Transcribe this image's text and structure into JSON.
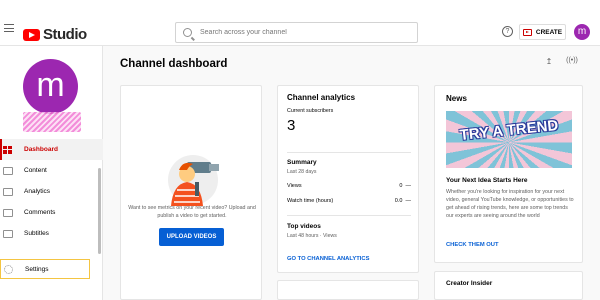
{
  "header": {
    "logo_text": "Studio",
    "search_placeholder": "Search across your channel",
    "help_icon_glyph": "?",
    "create_label": "CREATE",
    "avatar_letter": "m"
  },
  "sidebar": {
    "avatar_letter": "m",
    "items": [
      {
        "label": "Dashboard",
        "icon": "dashboard-icon",
        "active": true
      },
      {
        "label": "Content",
        "icon": "content-icon",
        "active": false
      },
      {
        "label": "Analytics",
        "icon": "analytics-icon",
        "active": false
      },
      {
        "label": "Comments",
        "icon": "comments-icon",
        "active": false
      },
      {
        "label": "Subtitles",
        "icon": "subtitles-icon",
        "active": false
      }
    ],
    "settings_label": "Settings"
  },
  "main": {
    "title": "Channel dashboard",
    "upload_card": {
      "text": "Want to see metrics on your recent video? Upload and publish a video to get started.",
      "button_label": "UPLOAD VIDEOS"
    },
    "analytics_card": {
      "title": "Channel analytics",
      "subscribers_label": "Current subscribers",
      "subscribers_value": "3",
      "summary_title": "Summary",
      "summary_period": "Last 28 days",
      "rows": [
        {
          "label": "Views",
          "value": "0",
          "trend": "—"
        },
        {
          "label": "Watch time (hours)",
          "value": "0.0",
          "trend": "—"
        }
      ],
      "top_videos_title": "Top videos",
      "top_videos_period": "Last 48 hours · Views",
      "link_label": "GO TO CHANNEL ANALYTICS"
    },
    "news_card": {
      "title": "News",
      "banner_text": "TRY A TREND",
      "headline": "Your Next Idea Starts Here",
      "body": "Whether you're looking for inspiration for your next video, general YouTube knowledge, or opportunities to get ahead of rising trends, here are some top trends our experts are seeing around the world",
      "link_label": "CHECK THEM OUT"
    },
    "insider_card": {
      "title": "Creator Insider"
    }
  },
  "colors": {
    "brand_red": "#ff0000",
    "active_red": "#cc0000",
    "link_blue": "#065fd4",
    "avatar_purple": "#9c27b0"
  }
}
